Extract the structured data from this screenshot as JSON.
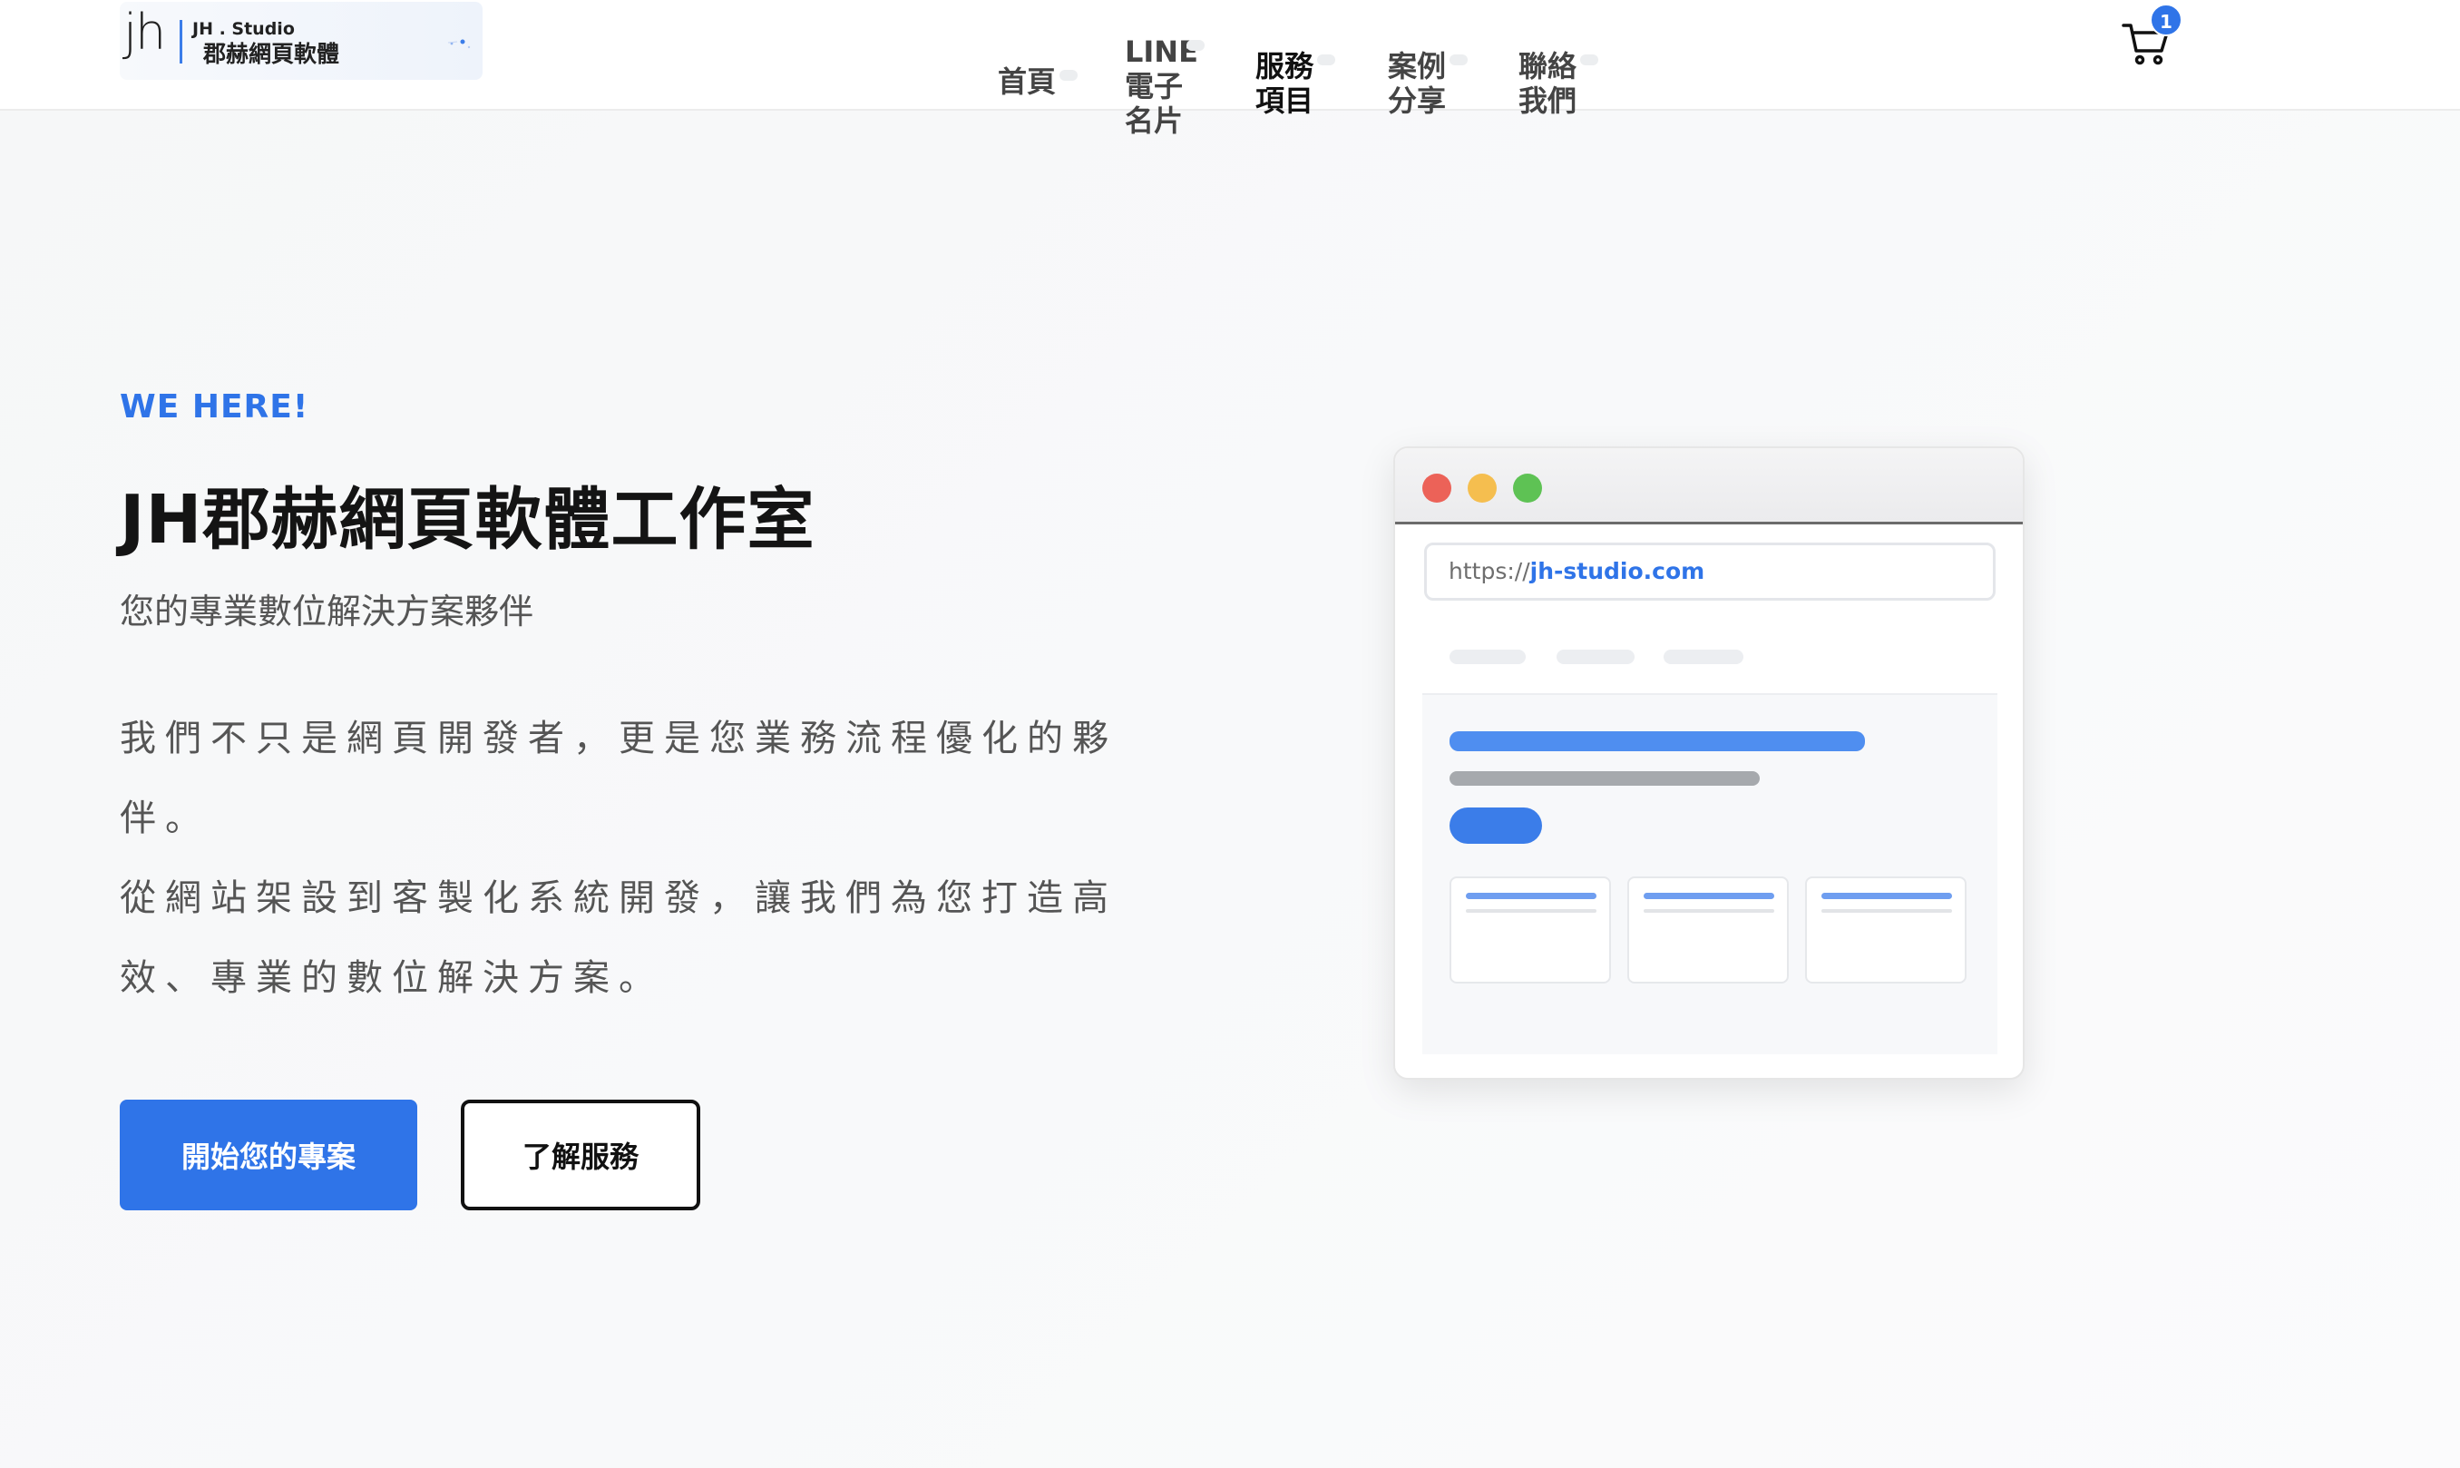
{
  "logo": {
    "mark": "jh",
    "name_en": "JH . Studio",
    "name_zh": "郡赫網頁軟體"
  },
  "nav": {
    "items": [
      {
        "label": "首頁"
      },
      {
        "label": "LINE\n電子\n名片"
      },
      {
        "label": "服務\n項目"
      },
      {
        "label": "案例\n分享"
      },
      {
        "label": "聯絡\n我們"
      }
    ],
    "active_index": 2
  },
  "cart": {
    "icon": "cart-icon",
    "count": "1"
  },
  "hero": {
    "eyebrow": "WE HERE!",
    "title": "JH郡赫網頁軟體工作室",
    "subtitle": "您的專業數位解決方案夥伴",
    "desc_line1": "我們不只是網頁開發者，更是您業務流程優化的夥伴。",
    "desc_line2": "從網站架設到客製化系統開發，讓我們為您打造高效、專業的數位解決方案。",
    "primary_button": "開始您的專案",
    "secondary_button": "了解服務"
  },
  "mockup": {
    "url_protocol": "https://",
    "url_domain": "jh-studio.com"
  },
  "colors": {
    "accent": "#2f74e8",
    "dot_red": "#ec6258",
    "dot_yellow": "#f5be4f",
    "dot_green": "#5ec254"
  }
}
